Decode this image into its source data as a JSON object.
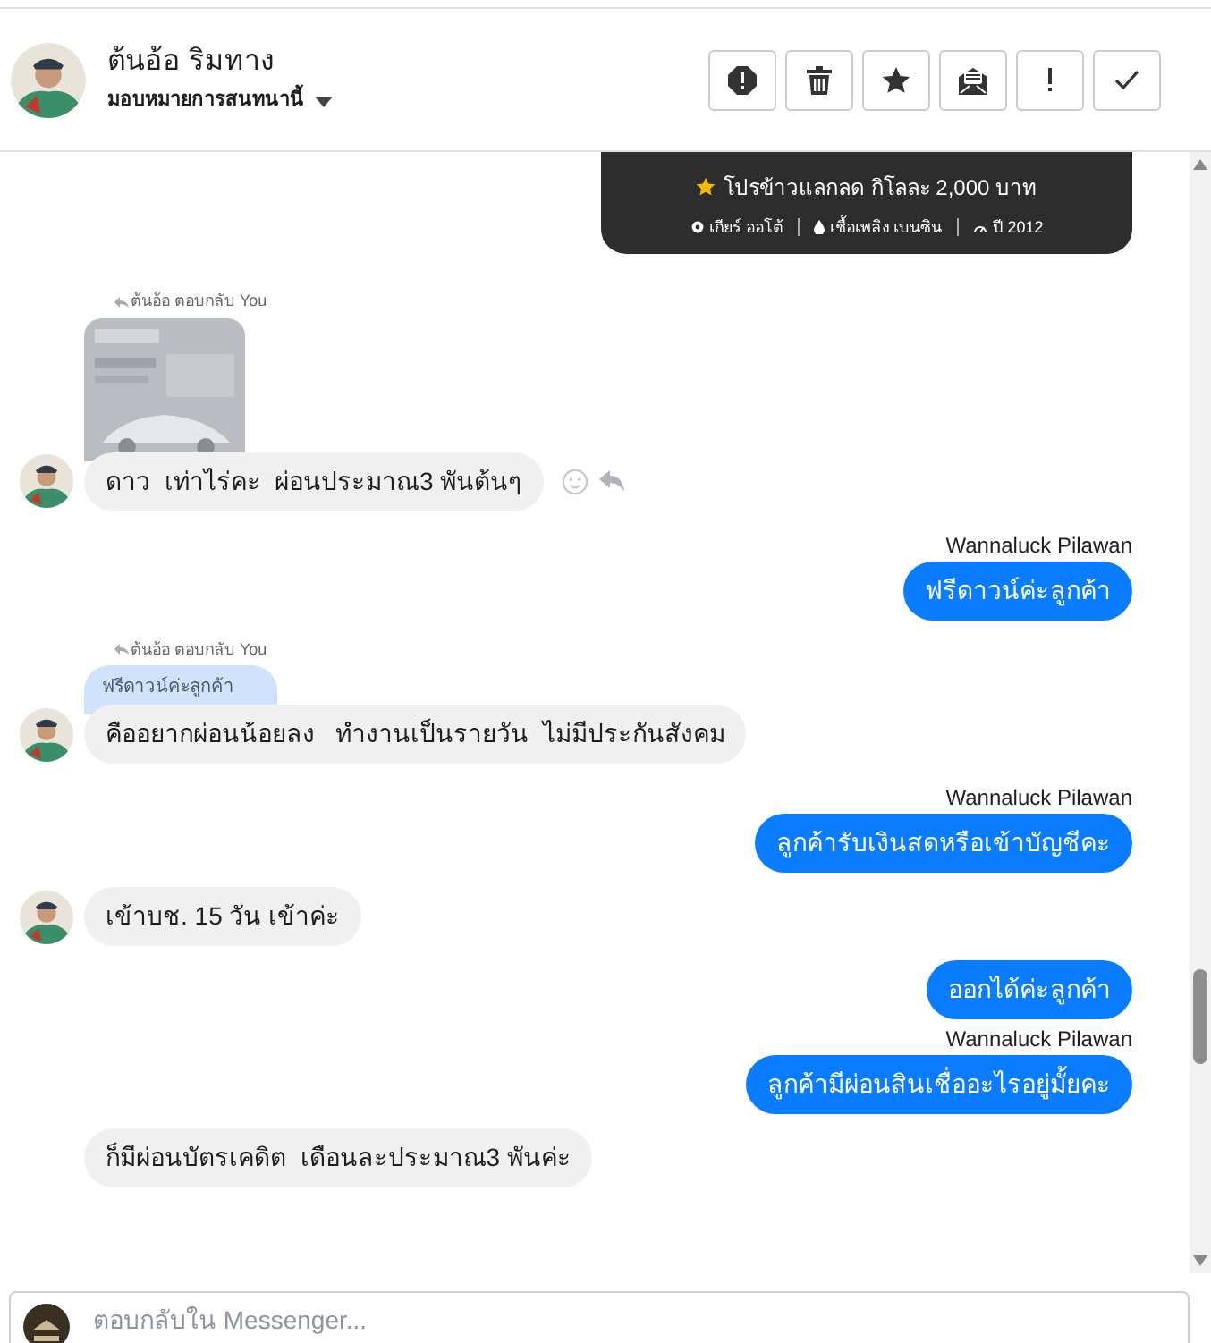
{
  "header": {
    "name": "ต้นอ้อ ริมทาง",
    "subtitle": "มอบหมายการสนทนานี้",
    "actions": [
      {
        "kind": "spam"
      },
      {
        "kind": "delete"
      },
      {
        "kind": "star"
      },
      {
        "kind": "unread"
      },
      {
        "kind": "important"
      },
      {
        "kind": "done"
      }
    ]
  },
  "messages": [
    {
      "kind": "card",
      "promo": "โปรข้าวแลกลด กิโลละ 2,000 บาท",
      "specs": [
        {
          "kind": "gear",
          "text": "เกียร์ ออโต้"
        },
        {
          "kind": "fuel",
          "text": "เชื้อเพลิง เบนซิน"
        },
        {
          "kind": "year",
          "text": "ปี 2012"
        }
      ]
    },
    {
      "kind": "incoming",
      "reply_label": "ต้นอ้อ ตอบกลับ You",
      "text": "ดาว  เท่าไร่คะ  ผ่อนประมาณ3 พันต้นๆ",
      "show_avatar": true,
      "hover_actions": true
    },
    {
      "kind": "outgoing",
      "sender": "Wannaluck Pilawan",
      "text": "ฟรีดาวน์ค่ะลูกค้า"
    },
    {
      "kind": "incoming",
      "reply_label": "ต้นอ้อ ตอบกลับ You",
      "quote": {
        "kind": "text",
        "text": "ฟรีดาวน์ค่ะลูกค้า"
      },
      "text": "คืออยากผ่อนน้อยลง   ทำงานเป็นรายวัน  ไม่มีประกันสังคม",
      "show_avatar": true,
      "hover_actions": false
    },
    {
      "kind": "outgoing",
      "sender": "Wannaluck Pilawan",
      "text": "ลูกค้ารับเงินสดหรือเข้าบัญชีคะ"
    },
    {
      "kind": "incoming",
      "text": "เข้าบช. 15 วัน เข้าค่ะ",
      "show_avatar": true,
      "hover_actions": false
    },
    {
      "kind": "outgoing",
      "text": "ออกได้ค่ะลูกค้า"
    },
    {
      "kind": "outgoing",
      "sender": "Wannaluck Pilawan",
      "text": "ลูกค้ามีผ่อนสินเชื่ออะไรอยู่มั้ยคะ"
    },
    {
      "kind": "incoming",
      "text": "ก็มีผ่อนบัตรเคดิต  เดือนละประมาณ3 พันค่ะ",
      "show_avatar": false,
      "hover_actions": false
    }
  ],
  "composer": {
    "placeholder": "ตอบกลับใน Messenger..."
  }
}
